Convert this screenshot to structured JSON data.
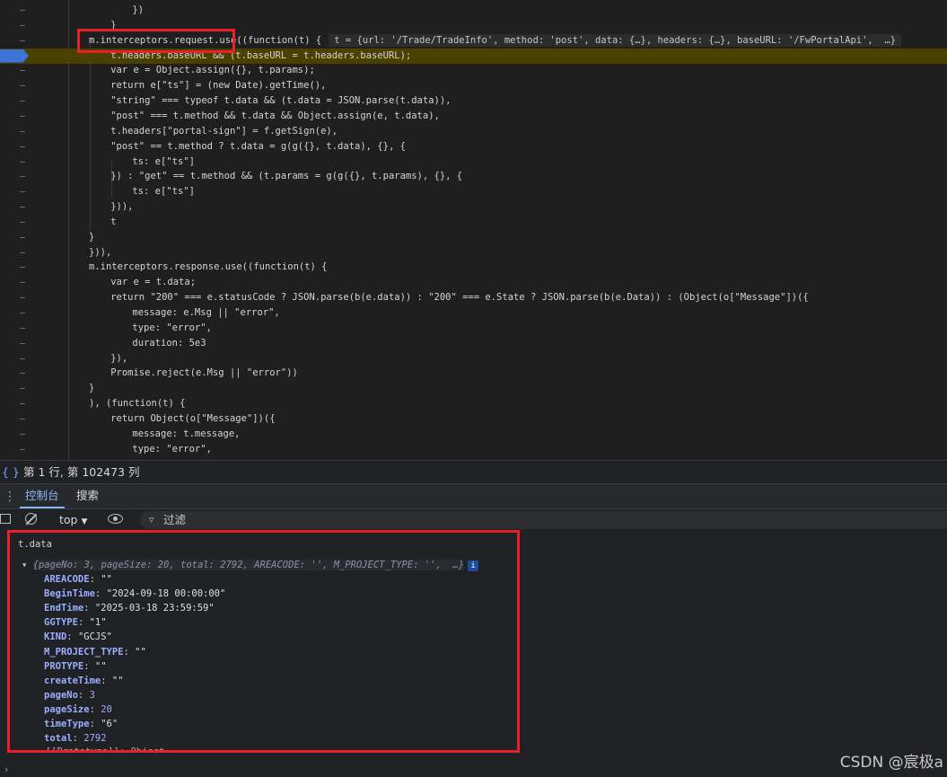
{
  "editor": {
    "lines": [
      {
        "indent": "        ",
        "html": "})"
      },
      {
        "indent": "    ",
        "html": "}"
      },
      {
        "indent": "",
        "code": "m.interceptors.request.use((function(t) {",
        "inline": "t = {url: '/Trade/TradeInfo', method: 'post', data: {…}, headers: {…}, baseURL: '/FwPortalApi',  …}"
      },
      {
        "indent": "    ",
        "code": "t.headers.baseURL && (t.baseURL = t.headers.baseURL);",
        "highlight": true
      },
      {
        "indent": "    ",
        "code": "var e = Object.assign({}, t.params);"
      },
      {
        "indent": "    ",
        "code": "return e[\"ts\"] = (new Date).getTime(),"
      },
      {
        "indent": "    ",
        "code": "\"string\" === typeof t.data && (t.data = JSON.parse(t.data)),"
      },
      {
        "indent": "    ",
        "code": "\"post\" === t.method && t.data && Object.assign(e, t.data),"
      },
      {
        "indent": "    ",
        "code": "t.headers[\"portal-sign\"] = f.getSign(e),"
      },
      {
        "indent": "    ",
        "code": "\"post\" == t.method ? t.data = g(g({}, t.data), {}, {"
      },
      {
        "indent": "        ",
        "code": "ts: e[\"ts\"]"
      },
      {
        "indent": "    ",
        "code": "}) : \"get\" == t.method && (t.params = g(g({}, t.params), {}, {"
      },
      {
        "indent": "        ",
        "code": "ts: e[\"ts\"]"
      },
      {
        "indent": "    ",
        "code": "})),"
      },
      {
        "indent": "    ",
        "code": "t"
      },
      {
        "indent": "",
        "code": "}"
      },
      {
        "indent": "",
        "code": "})),"
      },
      {
        "indent": "",
        "code": "m.interceptors.response.use((function(t) {"
      },
      {
        "indent": "    ",
        "code": "var e = t.data;"
      },
      {
        "indent": "    ",
        "code": "return \"200\" === e.statusCode ? JSON.parse(b(e.data)) : \"200\" === e.State ? JSON.parse(b(e.Data)) : (Object(o[\"Message\"])({"
      },
      {
        "indent": "        ",
        "code": "message: e.Msg || \"error\","
      },
      {
        "indent": "        ",
        "code": "type: \"error\","
      },
      {
        "indent": "        ",
        "code": "duration: 5e3"
      },
      {
        "indent": "    ",
        "code": "}),"
      },
      {
        "indent": "    ",
        "code": "Promise.reject(e.Msg || \"error\"))"
      },
      {
        "indent": "",
        "code": "}"
      },
      {
        "indent": "",
        "code": "), (function(t) {"
      },
      {
        "indent": "    ",
        "code": "return Object(o[\"Message\"])({"
      },
      {
        "indent": "        ",
        "code": "message: t.message,"
      },
      {
        "indent": "        ",
        "code": "type: \"error\","
      }
    ]
  },
  "status": {
    "braces": "{ }",
    "position": "第 1 行, 第 102473 列"
  },
  "tabs": {
    "console": "控制台",
    "search": "搜索"
  },
  "toolbar": {
    "context": "top",
    "filter_placeholder": "过滤"
  },
  "console": {
    "expression": "t.data",
    "preview": "{pageNo: 3, pageSize: 20, total: 2792, AREACODE: '', M_PROJECT_TYPE: '',  …}",
    "info_badge": "i",
    "props": [
      {
        "key": "AREACODE",
        "value": "\"\"",
        "kind": "str"
      },
      {
        "key": "BeginTime",
        "value": "\"2024-09-18 00:00:00\"",
        "kind": "str"
      },
      {
        "key": "EndTime",
        "value": "\"2025-03-18 23:59:59\"",
        "kind": "str"
      },
      {
        "key": "GGTYPE",
        "value": "\"1\"",
        "kind": "str"
      },
      {
        "key": "KIND",
        "value": "\"GCJS\"",
        "kind": "str"
      },
      {
        "key": "M_PROJECT_TYPE",
        "value": "\"\"",
        "kind": "str"
      },
      {
        "key": "PROTYPE",
        "value": "\"\"",
        "kind": "str"
      },
      {
        "key": "createTime",
        "value": "\"\"",
        "kind": "str"
      },
      {
        "key": "pageNo",
        "value": "3",
        "kind": "num"
      },
      {
        "key": "pageSize",
        "value": "20",
        "kind": "num"
      },
      {
        "key": "timeType",
        "value": "\"6\"",
        "kind": "str"
      },
      {
        "key": "total",
        "value": "2792",
        "kind": "num"
      }
    ],
    "prototype": "[[Prototype]]: Object"
  },
  "watermark": "CSDN @宸极a",
  "colors": {
    "annotation_box": "#e8202a",
    "breakpoint": "#3b74d9",
    "paused_line": "#4a4000"
  }
}
